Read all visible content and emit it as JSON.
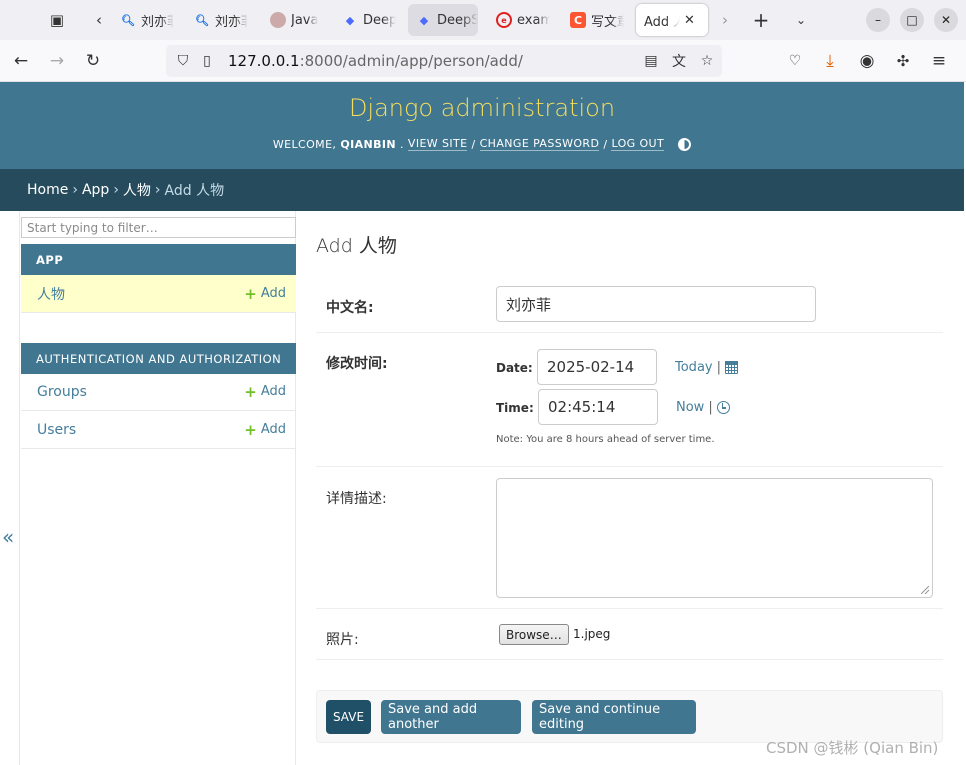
{
  "browser": {
    "tabs": [
      {
        "title": "刘亦菲"
      },
      {
        "title": "刘亦菲"
      },
      {
        "title": "Java"
      },
      {
        "title": "DeepSeek"
      },
      {
        "title": "DeepSeek"
      },
      {
        "title": "example"
      },
      {
        "title": "写文章"
      },
      {
        "title": "Add 人物"
      }
    ],
    "url_host": "127.0.0.1",
    "url_rest": ":8000/admin/app/person/add/"
  },
  "header": {
    "brand": "Django administration",
    "welcome": "WELCOME,",
    "username": "QIANBIN",
    "view_site": "VIEW SITE",
    "change_password": "CHANGE PASSWORD",
    "log_out": "LOG OUT",
    "slash": "/"
  },
  "breadcrumbs": {
    "home": "Home",
    "app": "App",
    "model": "人物",
    "current": "Add 人物",
    "sep": "›"
  },
  "sidebar": {
    "filter_placeholder": "Start typing to filter…",
    "modules": [
      {
        "caption": "APP",
        "models": [
          {
            "name": "人物",
            "add": "Add"
          }
        ]
      },
      {
        "caption": "AUTHENTICATION AND AUTHORIZATION",
        "models": [
          {
            "name": "Groups",
            "add": "Add"
          },
          {
            "name": "Users",
            "add": "Add"
          }
        ]
      }
    ],
    "collapse": "«"
  },
  "content": {
    "title": "Add 人物",
    "fields": {
      "name": {
        "label": "中文名:",
        "value": "刘亦菲"
      },
      "modified": {
        "label": "修改时间:",
        "date_label": "Date:",
        "date_value": "2025-02-14",
        "today": "Today",
        "time_label": "Time:",
        "time_value": "02:45:14",
        "now": "Now",
        "bar": "|",
        "note": "Note: You are 8 hours ahead of server time."
      },
      "description": {
        "label": "详情描述:",
        "value": ""
      },
      "photo": {
        "label": "照片:",
        "browse": "Browse…",
        "file": "1.jpeg"
      }
    },
    "buttons": {
      "save": "SAVE",
      "save_add": "Save and add another",
      "save_continue": "Save and continue editing"
    }
  },
  "watermark": "CSDN @钱彬 (Qian Bin)",
  "colors": {
    "header_bg": "#417690",
    "brand": "#f5dd5d",
    "breadcrumb_bg": "#264b5d",
    "link": "#447e9b",
    "add_plus": "#70bf2b",
    "current_row": "#ffffcc",
    "default_button": "#205067"
  }
}
